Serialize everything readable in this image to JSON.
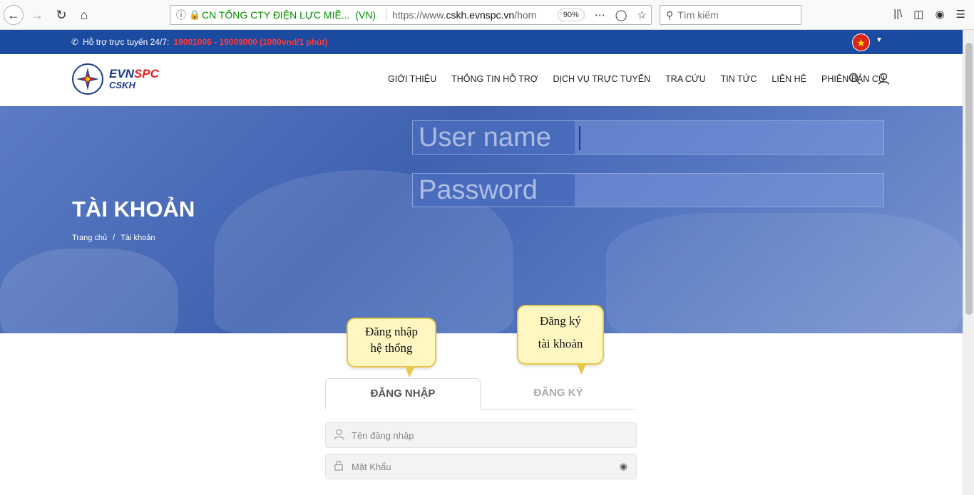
{
  "browser": {
    "site_identity": "CN TỔNG CTY ĐIỆN LỰC MIỀ...",
    "site_country": "(VN)",
    "url_prefix": "https://www.",
    "url_domain": "cskh.evnspc.vn",
    "url_suffix": "/hom",
    "zoom": "90%",
    "search_placeholder": "Tìm kiếm"
  },
  "topbar": {
    "support_label": "Hỗ trợ trực tuyến 24/7:",
    "hotline": "19001006 - 19009000 (1000vnd/1 phút)"
  },
  "logo": {
    "evn": "EVN",
    "spc": "SPC",
    "cskh": "CSKH"
  },
  "menu": [
    "GIỚI THIỆU",
    "THÔNG TIN HỖ TRỢ",
    "DỊCH VỤ TRỰC TUYẾN",
    "TRA CỨU",
    "TIN TỨC",
    "LIÊN HỆ",
    "PHIÊN BẢN CŨ"
  ],
  "hero": {
    "username_label": "User name",
    "password_label": "Password",
    "title": "TÀI KHOẢN",
    "breadcrumb_home": "Trang chủ",
    "breadcrumb_sep": "/",
    "breadcrumb_current": "Tài khoản"
  },
  "callouts": {
    "login_line1": "Đăng nhập",
    "login_line2": "hệ thống",
    "register_line1": "Đăng ký",
    "register_line2": "tài khoản"
  },
  "tabs": {
    "login": "ĐĂNG NHẬP",
    "register": "ĐĂNG KÝ"
  },
  "form": {
    "username_placeholder": "Tên đăng nhập",
    "password_placeholder": "Mật Khẩu"
  }
}
